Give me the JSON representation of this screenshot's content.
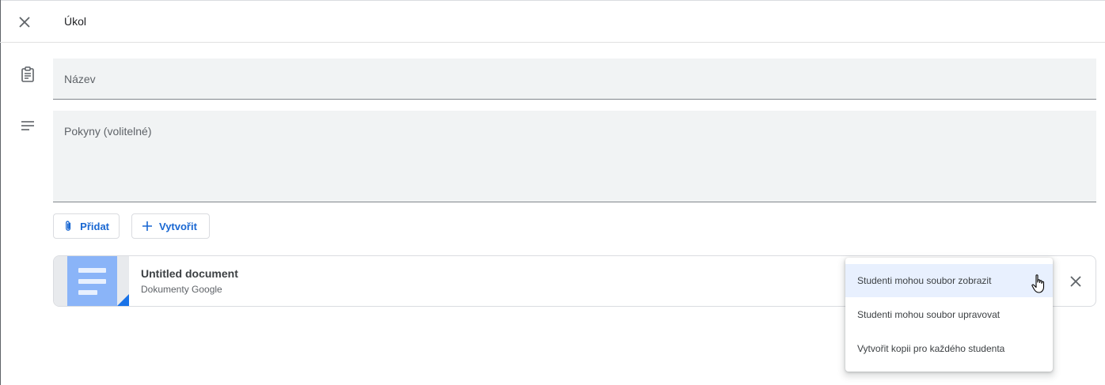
{
  "header": {
    "title": "Úkol",
    "close_icon": "close-icon"
  },
  "form": {
    "title_placeholder": "Název",
    "instructions_placeholder": "Pokyny (volitelné)",
    "title_icon": "assignment-icon",
    "instructions_icon": "notes-icon"
  },
  "buttons": {
    "add_label": "Přidat",
    "add_icon": "paperclip-icon",
    "create_label": "Vytvořit",
    "create_icon": "plus-icon"
  },
  "attachment": {
    "title": "Untitled document",
    "subtitle": "Dokumenty Google",
    "thumbnail_icon": "google-docs-icon"
  },
  "share_menu": {
    "items": [
      {
        "label": "Studenti mohou soubor zobrazit",
        "selected": true
      },
      {
        "label": "Studenti mohou soubor upravovat",
        "selected": false
      },
      {
        "label": "Vytvořit kopii pro každého studenta",
        "selected": false
      }
    ]
  },
  "colors": {
    "accent": "#1967d2",
    "doc_blue": "#8ab4f8",
    "field_bg": "#f1f3f4",
    "menu_highlight": "#e8f0fe"
  }
}
